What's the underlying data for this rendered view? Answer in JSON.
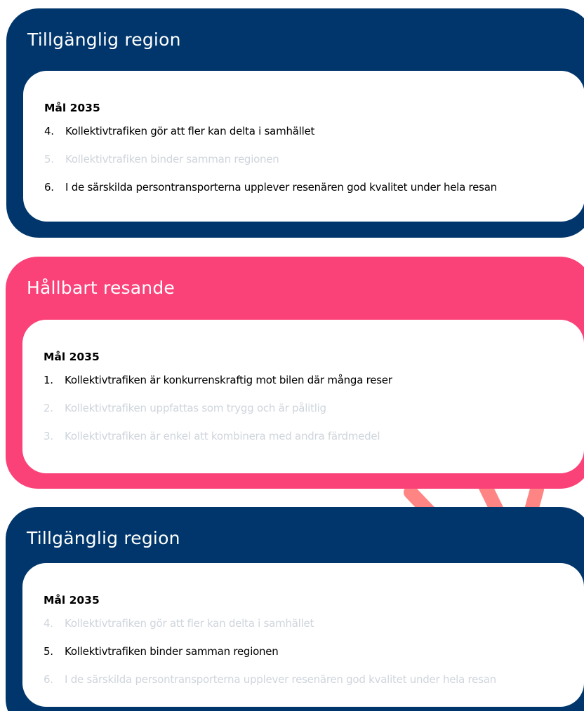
{
  "colors": {
    "navy": "#00366b",
    "pink": "#fa4279",
    "arrow": "#ff8585",
    "dim_text": "#cfd5dc"
  },
  "cards": [
    {
      "title": "Tillgänglig region",
      "heading": "Mål 2035",
      "items": [
        {
          "num": "4.",
          "text": "Kollektivtrafiken gör att fler kan delta i samhället",
          "active": true
        },
        {
          "num": "5.",
          "text": "Kollektivtrafiken binder samman regionen",
          "active": false
        },
        {
          "num": "6.",
          "text": "I de särskilda persontransporterna upplever resenären god kvalitet under hela resan",
          "active": true
        }
      ]
    },
    {
      "title": "Hållbart resande",
      "heading": "Mål 2035",
      "items": [
        {
          "num": "1.",
          "text": "Kollektivtrafiken är konkurrenskraftig mot bilen där många reser",
          "active": true
        },
        {
          "num": "2.",
          "text": "Kollektivtrafiken uppfattas som trygg och är pålitlig",
          "active": false
        },
        {
          "num": "3.",
          "text": "Kollektivtrafiken är enkel att kombinera med andra färdmedel",
          "active": false
        }
      ]
    },
    {
      "title": "Tillgänglig region",
      "heading": "Mål 2035",
      "items": [
        {
          "num": "4.",
          "text": "Kollektivtrafiken gör att fler kan delta i samhället",
          "active": false
        },
        {
          "num": "5.",
          "text": "Kollektivtrafiken binder samman regionen",
          "active": true
        },
        {
          "num": "6.",
          "text": "I de särskilda persontransporterna upplever resenären god kvalitet under hela resan",
          "active": false
        }
      ]
    }
  ]
}
